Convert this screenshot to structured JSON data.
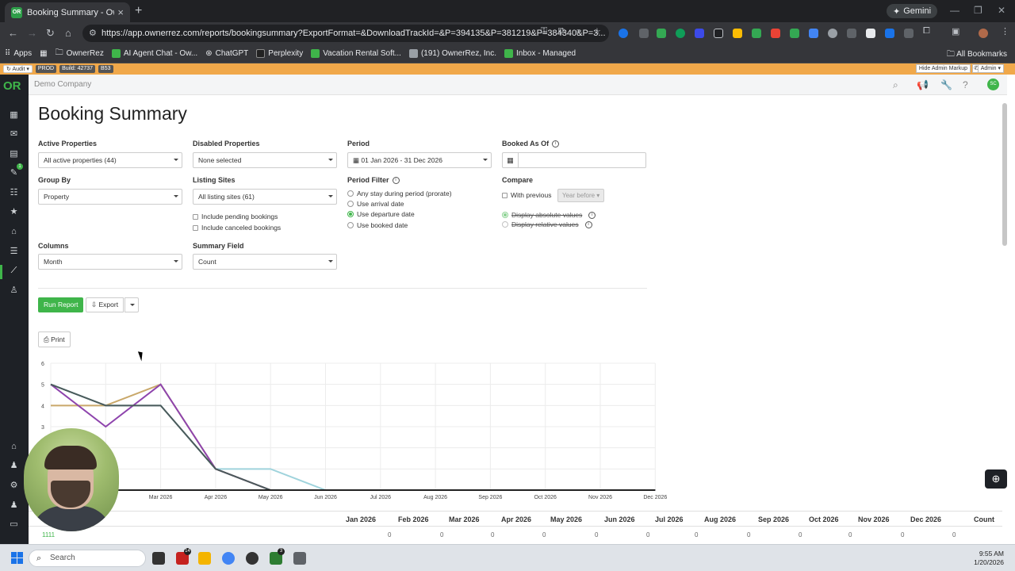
{
  "browser": {
    "tab_title": "Booking Summary - OwnerRez",
    "tab_favicon": "OR",
    "url": "https://app.ownerrez.com/reports/bookingsummary?ExportFormat=&DownloadTrackId=&P=394135&P=381219&P=384340&P=3...",
    "gemini_label": "Gemini",
    "bookmarks": [
      "Apps",
      "OwnerRez",
      "AI Agent Chat - Ow...",
      "ChatGPT",
      "Perplexity",
      "Vacation Rental Soft...",
      "(191) OwnerRez, Inc.",
      "Inbox - Managed"
    ],
    "all_bookmarks": "All Bookmarks"
  },
  "adminbar": {
    "audit": "Audit",
    "prod": "PROD",
    "build": "Build: 42737",
    "b53": "B53",
    "hide_markup": "Hide Admin Markup",
    "admin": "Admin"
  },
  "app": {
    "logo": "OR",
    "company": "Demo Company",
    "avatar": "SC",
    "nav_badge": "1",
    "accent": "#3fb54a"
  },
  "page": {
    "title": "Booking Summary",
    "filters": {
      "active_properties": {
        "label": "Active Properties",
        "value": "All active properties (44)"
      },
      "disabled_properties": {
        "label": "Disabled Properties",
        "value": "None selected"
      },
      "period": {
        "label": "Period",
        "value": "01 Jan 2026 - 31 Dec 2026"
      },
      "booked_as_of": {
        "label": "Booked As Of",
        "value": ""
      },
      "group_by": {
        "label": "Group By",
        "value": "Property"
      },
      "listing_sites": {
        "label": "Listing Sites",
        "value": "All listing sites (61)"
      },
      "include_pending": "Include pending bookings",
      "include_canceled": "Include canceled bookings",
      "period_filter": {
        "label": "Period Filter",
        "options": [
          "Any stay during period (prorate)",
          "Use arrival date",
          "Use departure date",
          "Use booked date"
        ],
        "selected": "Use departure date"
      },
      "compare": {
        "label": "Compare",
        "with_previous": "With previous",
        "year_before": "Year before",
        "display_absolute": "Display absolute values",
        "display_relative": "Display relative values"
      },
      "columns": {
        "label": "Columns",
        "value": "Month"
      },
      "summary_field": {
        "label": "Summary Field",
        "value": "Count"
      }
    },
    "buttons": {
      "run_report": "Run Report",
      "export": "Export",
      "print": "Print"
    }
  },
  "chart_data": {
    "type": "line",
    "categories": [
      "Jan 2026",
      "Feb 2026",
      "Mar 2026",
      "Apr 2026",
      "May 2026",
      "Jun 2026",
      "Jul 2026",
      "Aug 2026",
      "Sep 2026",
      "Oct 2026",
      "Nov 2026",
      "Dec 2026"
    ],
    "x_tick_labels": [
      "Mar 2026",
      "Apr 2026",
      "May 2026",
      "Jun 2026",
      "Jul 2026",
      "Aug 2026",
      "Sep 2026",
      "Oct 2026",
      "Nov 2026",
      "Dec 2026"
    ],
    "y_ticks": [
      3,
      4,
      5,
      6
    ],
    "ylim": [
      0,
      6
    ],
    "grid": true,
    "series": [
      {
        "color": "#c9a86a",
        "values": [
          4,
          4,
          5,
          1,
          0,
          0,
          0,
          0,
          0,
          0,
          0,
          0
        ]
      },
      {
        "color": "#9fd3dc",
        "values": [
          5,
          4,
          4,
          1,
          1,
          0,
          0,
          0,
          0,
          0,
          0,
          0
        ]
      },
      {
        "color": "#8e44ad",
        "values": [
          5,
          3,
          5,
          1,
          0,
          0,
          0,
          0,
          0,
          0,
          0,
          0
        ]
      },
      {
        "color": "#4a5a5a",
        "values": [
          5,
          4,
          4,
          1,
          0,
          0,
          0,
          0,
          0,
          0,
          0,
          0
        ]
      },
      {
        "color": "#222222",
        "values": [
          0,
          0,
          0,
          0,
          0,
          0,
          0,
          0,
          0,
          0,
          0,
          0
        ]
      }
    ]
  },
  "table": {
    "headers": [
      "Jan 2026",
      "Feb 2026",
      "Mar 2026",
      "Apr 2026",
      "May 2026",
      "Jun 2026",
      "Jul 2026",
      "Aug 2026",
      "Sep 2026",
      "Oct 2026",
      "Nov 2026",
      "Dec 2026",
      "Count"
    ],
    "rows": [
      {
        "name": "1111",
        "values": [
          "0",
          "0",
          "0",
          "0",
          "0",
          "0",
          "0",
          "0",
          "0",
          "0",
          "0",
          "0"
        ]
      }
    ]
  },
  "taskbar": {
    "search": "Search",
    "time": "9:55 AM",
    "date": "1/20/2026",
    "badge_mail": "14",
    "badge_app": "3"
  }
}
